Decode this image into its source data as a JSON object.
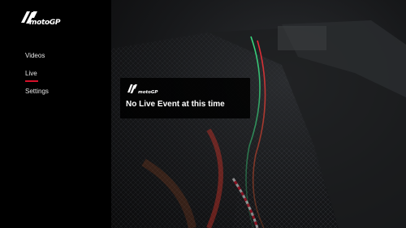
{
  "brand": {
    "name": "motoGP",
    "logo_icon": "motogp-logo-icon",
    "accent": "#d5102a"
  },
  "nav": {
    "items": [
      {
        "label": "Videos",
        "active": false
      },
      {
        "label": "Live",
        "active": true
      },
      {
        "label": "Settings",
        "active": false
      }
    ]
  },
  "message": {
    "text": "No Live Event at this time"
  }
}
